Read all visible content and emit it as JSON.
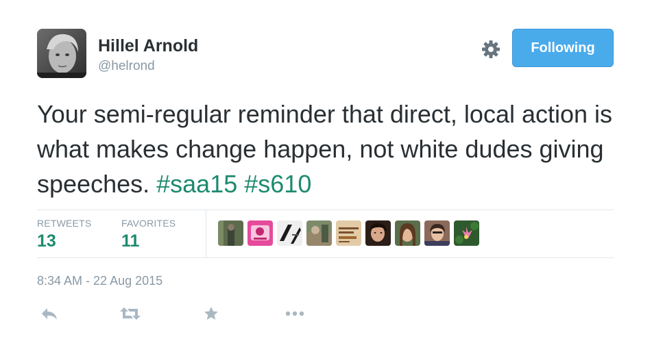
{
  "author": {
    "name": "Hillel Arnold",
    "handle": "@helrond"
  },
  "follow_button": {
    "label": "Following"
  },
  "tweet": {
    "text_main": "Your semi-regular reminder that direct, local action is what makes change happen, not white dudes giving speeches.",
    "hashtags": [
      "#saa15",
      "#s610"
    ]
  },
  "stats": {
    "retweets_label": "RETWEETS",
    "retweets_count": "13",
    "favorites_label": "FAVORITES",
    "favorites_count": "11"
  },
  "favoriter_avatar_count": 9,
  "timestamp": "8:34 AM - 22 Aug 2015",
  "actions": [
    "reply-icon",
    "retweet-icon",
    "favorite-icon",
    "more-icon"
  ],
  "colors": {
    "link": "#1d8a6f",
    "button": "#4aabeb",
    "muted": "#8899a6",
    "text": "#292f33"
  }
}
